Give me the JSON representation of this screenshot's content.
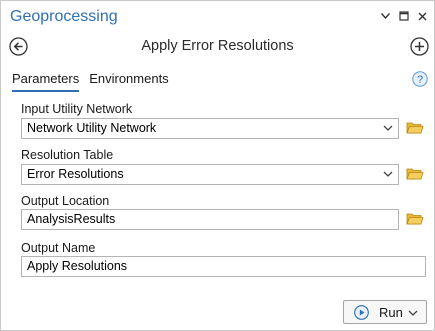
{
  "window": {
    "title": "Geoprocessing",
    "controls": {
      "options_icon": "chevron-down-icon",
      "restore_icon": "restore-window-icon",
      "close_icon": "close-icon"
    }
  },
  "tool": {
    "name": "Apply Error Resolutions",
    "back_icon": "back-arrow-icon",
    "add_icon": "add-icon"
  },
  "tabs": [
    {
      "label": "Parameters",
      "active": true
    },
    {
      "label": "Environments",
      "active": false
    }
  ],
  "help_icon": "help-icon",
  "parameters": {
    "input_utility_network": {
      "label": "Input Utility Network",
      "value": "Network Utility Network"
    },
    "resolution_table": {
      "label": "Resolution Table",
      "value": "Error Resolutions"
    },
    "output_location": {
      "label": "Output Location",
      "value": "AnalysisResults"
    },
    "output_name": {
      "label": "Output Name",
      "value": "Apply Resolutions"
    }
  },
  "run_button": {
    "label": "Run"
  },
  "colors": {
    "accent": "#2f6fb3",
    "folder": "#e8b93a",
    "border": "#b4b4b4"
  }
}
